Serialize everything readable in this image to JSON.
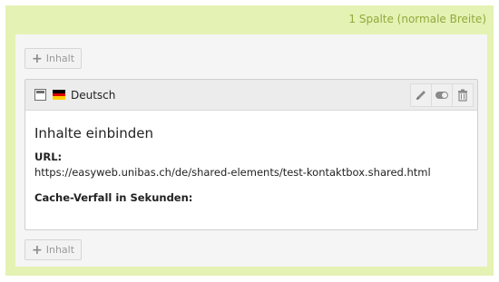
{
  "column": {
    "title": "1 Spalte (normale Breite)"
  },
  "add_buttons": {
    "top_label": "Inhalt",
    "bottom_label": "Inhalt",
    "plus": "+"
  },
  "element": {
    "language": "Deutsch",
    "title": "Inhalte einbinden",
    "fields": [
      {
        "label": "URL:",
        "value": "https://easyweb.unibas.ch/de/shared-elements/test-kontaktbox.shared.html"
      },
      {
        "label": "Cache-Verfall in Sekunden:",
        "value": ""
      }
    ],
    "actions": [
      "pencil-icon",
      "toggle-icon",
      "trash-icon"
    ]
  },
  "colors": {
    "outer_bg": "#e4f2b3",
    "column_title": "#8faa3d",
    "flag": [
      "#000000",
      "#dd0000",
      "#ffce00"
    ]
  }
}
